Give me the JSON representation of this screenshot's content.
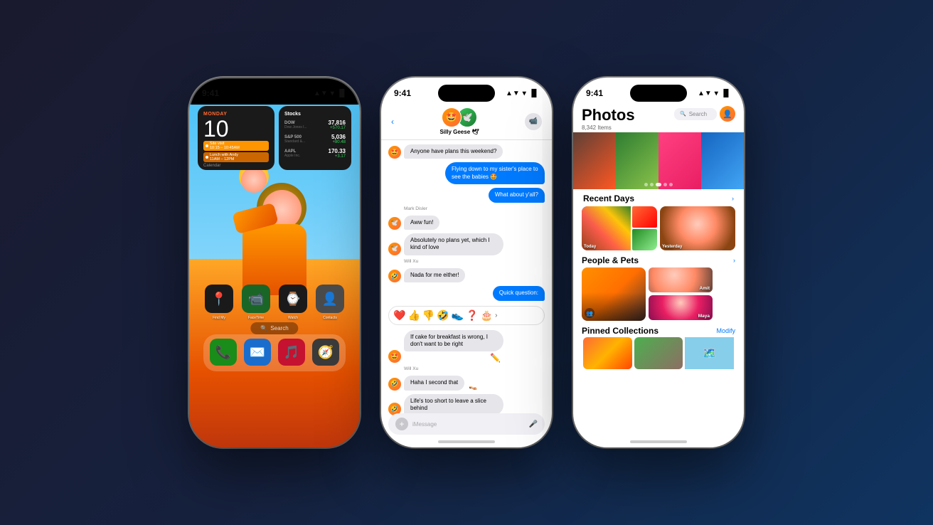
{
  "background": {
    "gradient_start": "#1a1a2e",
    "gradient_end": "#0f3460"
  },
  "phone1": {
    "status_time": "9:41",
    "status_icons": "▲▼ ⟨ ▐▌",
    "widget_calendar": {
      "day": "MONDAY",
      "date": "10",
      "event1_title": "Site visit",
      "event1_time": "10:15 – 10:45AM",
      "event2_title": "Lunch with Andy",
      "event2_time": "11AM – 12PM"
    },
    "widget_stocks": {
      "title": "Stocks",
      "dow": {
        "name": "DOW",
        "detail": "Dow Jones I...",
        "value": "37,816",
        "change": "+570.17"
      },
      "sp500": {
        "name": "S&P 500",
        "detail": "Standard &...",
        "value": "5,036",
        "change": "+80.48"
      },
      "aapl": {
        "name": "AAPL",
        "detail": "Apple Inc.",
        "value": "170.33",
        "change": "+3.17"
      }
    },
    "apps": [
      {
        "label": "Find My",
        "icon": "📍",
        "bg": "#1a1a1a"
      },
      {
        "label": "FaceTime",
        "icon": "📹",
        "bg": "#1a6626"
      },
      {
        "label": "Watch",
        "icon": "⌚",
        "bg": "#1a1a1a"
      },
      {
        "label": "Contacts",
        "icon": "👤",
        "bg": "#4a4a4a"
      }
    ],
    "dock_apps": [
      {
        "label": "Phone",
        "icon": "📞",
        "bg": "#1a8c1a"
      },
      {
        "label": "Mail",
        "icon": "✉️",
        "bg": "#1a6dcc"
      },
      {
        "label": "Music",
        "icon": "🎵",
        "bg": "#c41230"
      },
      {
        "label": "Compass",
        "icon": "🧭",
        "bg": "#3a3a3a"
      }
    ],
    "search_label": "🔍 Search",
    "calendar_label": "Calendar",
    "stocks_label": "Stocks"
  },
  "phone2": {
    "status_time": "9:41",
    "back_label": "< ",
    "group_name": "Silly Geese 🕊",
    "messages": [
      {
        "type": "received",
        "text": "Anyone have plans this weekend?",
        "sender": "group"
      },
      {
        "type": "sent",
        "text": "Flying down to my sister's place to see the babies 🤩"
      },
      {
        "type": "sent",
        "text": "What about y'all?"
      },
      {
        "type": "sender_label",
        "name": "Mark Disler"
      },
      {
        "type": "received",
        "text": "Aww fun!"
      },
      {
        "type": "received",
        "text": "Absolutely no plans yet, which I kind of love"
      },
      {
        "type": "sender_label",
        "name": "Will Xu"
      },
      {
        "type": "received",
        "text": "Nada for me either!"
      },
      {
        "type": "sent",
        "text": "Quick question:"
      },
      {
        "type": "reactions",
        "emojis": [
          "❤️",
          "👍",
          "👎",
          "🤣",
          "👟",
          "❓",
          "🎂"
        ]
      },
      {
        "type": "received",
        "text": "If cake for breakfast is wrong, I don't want to be right"
      },
      {
        "type": "sender_label",
        "name": "Will Xu"
      },
      {
        "type": "received",
        "text": "Haha I second that",
        "reaction": "👡"
      },
      {
        "type": "received",
        "text": "Life's too short to leave a slice behind"
      }
    ],
    "input_placeholder": "iMessage",
    "plus_icon": "+",
    "mic_icon": "🎤"
  },
  "phone3": {
    "status_time": "9:41",
    "title": "Photos",
    "item_count": "8,342 Items",
    "search_placeholder": "Search",
    "sections": {
      "recent_days": "Recent Days",
      "recent_days_chevron": "›",
      "people_pets": "People & Pets",
      "people_pets_chevron": "›",
      "pinned_collections": "Pinned Collections",
      "pinned_collections_chevron": "›",
      "modify_label": "Modify"
    },
    "recent_labels": [
      "Today",
      "Yesterday"
    ],
    "people_labels": [
      "Amit",
      "Maya"
    ],
    "hero_dots": 5,
    "hero_active_dot": 3
  }
}
